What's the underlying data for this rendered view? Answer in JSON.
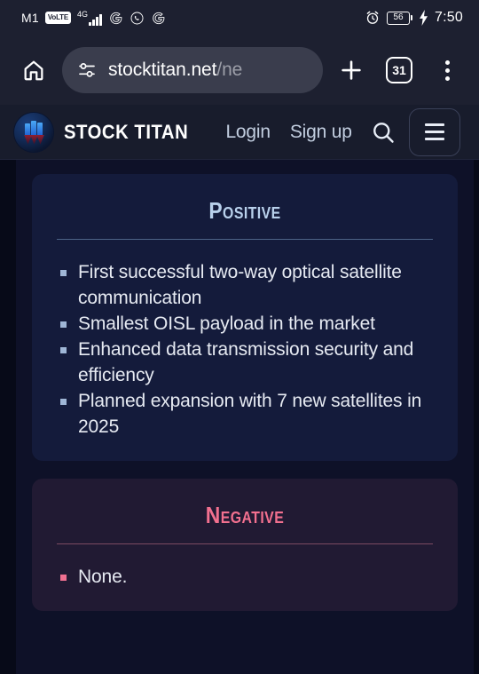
{
  "status_bar": {
    "carrier": "M1",
    "volte_label": "VoLTE",
    "network_type": "4G",
    "network_sup": "+",
    "icons": [
      "volte-badge",
      "signal-bars",
      "google-icon",
      "whatsapp-icon",
      "google-icon"
    ],
    "alarm_icon": "alarm-clock-icon",
    "battery_level": "56",
    "charging_icon": "charging-bolt-icon",
    "time": "7:50"
  },
  "browser": {
    "home_icon": "home-icon",
    "site_settings_icon": "site-settings-sliders-icon",
    "url_host": "stocktitan.net",
    "url_path": "/ne",
    "url_full": "stocktitan.net/ne",
    "new_tab_icon": "plus-icon",
    "tab_count": "31",
    "menu_icon": "kebab-menu-icon"
  },
  "site_header": {
    "logo_icon": "stock-titan-logo-icon",
    "brand": "STOCK TITAN",
    "login_label": "Login",
    "signup_label": "Sign up",
    "search_icon": "search-icon",
    "hamburger_icon": "hamburger-menu-icon"
  },
  "content": {
    "positive_card": {
      "title": "Positive",
      "title_color": "#b9d1ec",
      "background": "#141b3b",
      "bullet_color": "#9fb6d6",
      "items": [
        "First successful two-way optical satellite communication",
        "Smallest OISL payload in the market",
        "Enhanced data transmission security and efficiency",
        "Planned expansion with 7 new satellites in 2025"
      ]
    },
    "negative_card": {
      "title": "Negative",
      "title_color": "#f2708f",
      "background": "#211a33",
      "bullet_color": "#ef7091",
      "items": [
        "None."
      ]
    }
  }
}
